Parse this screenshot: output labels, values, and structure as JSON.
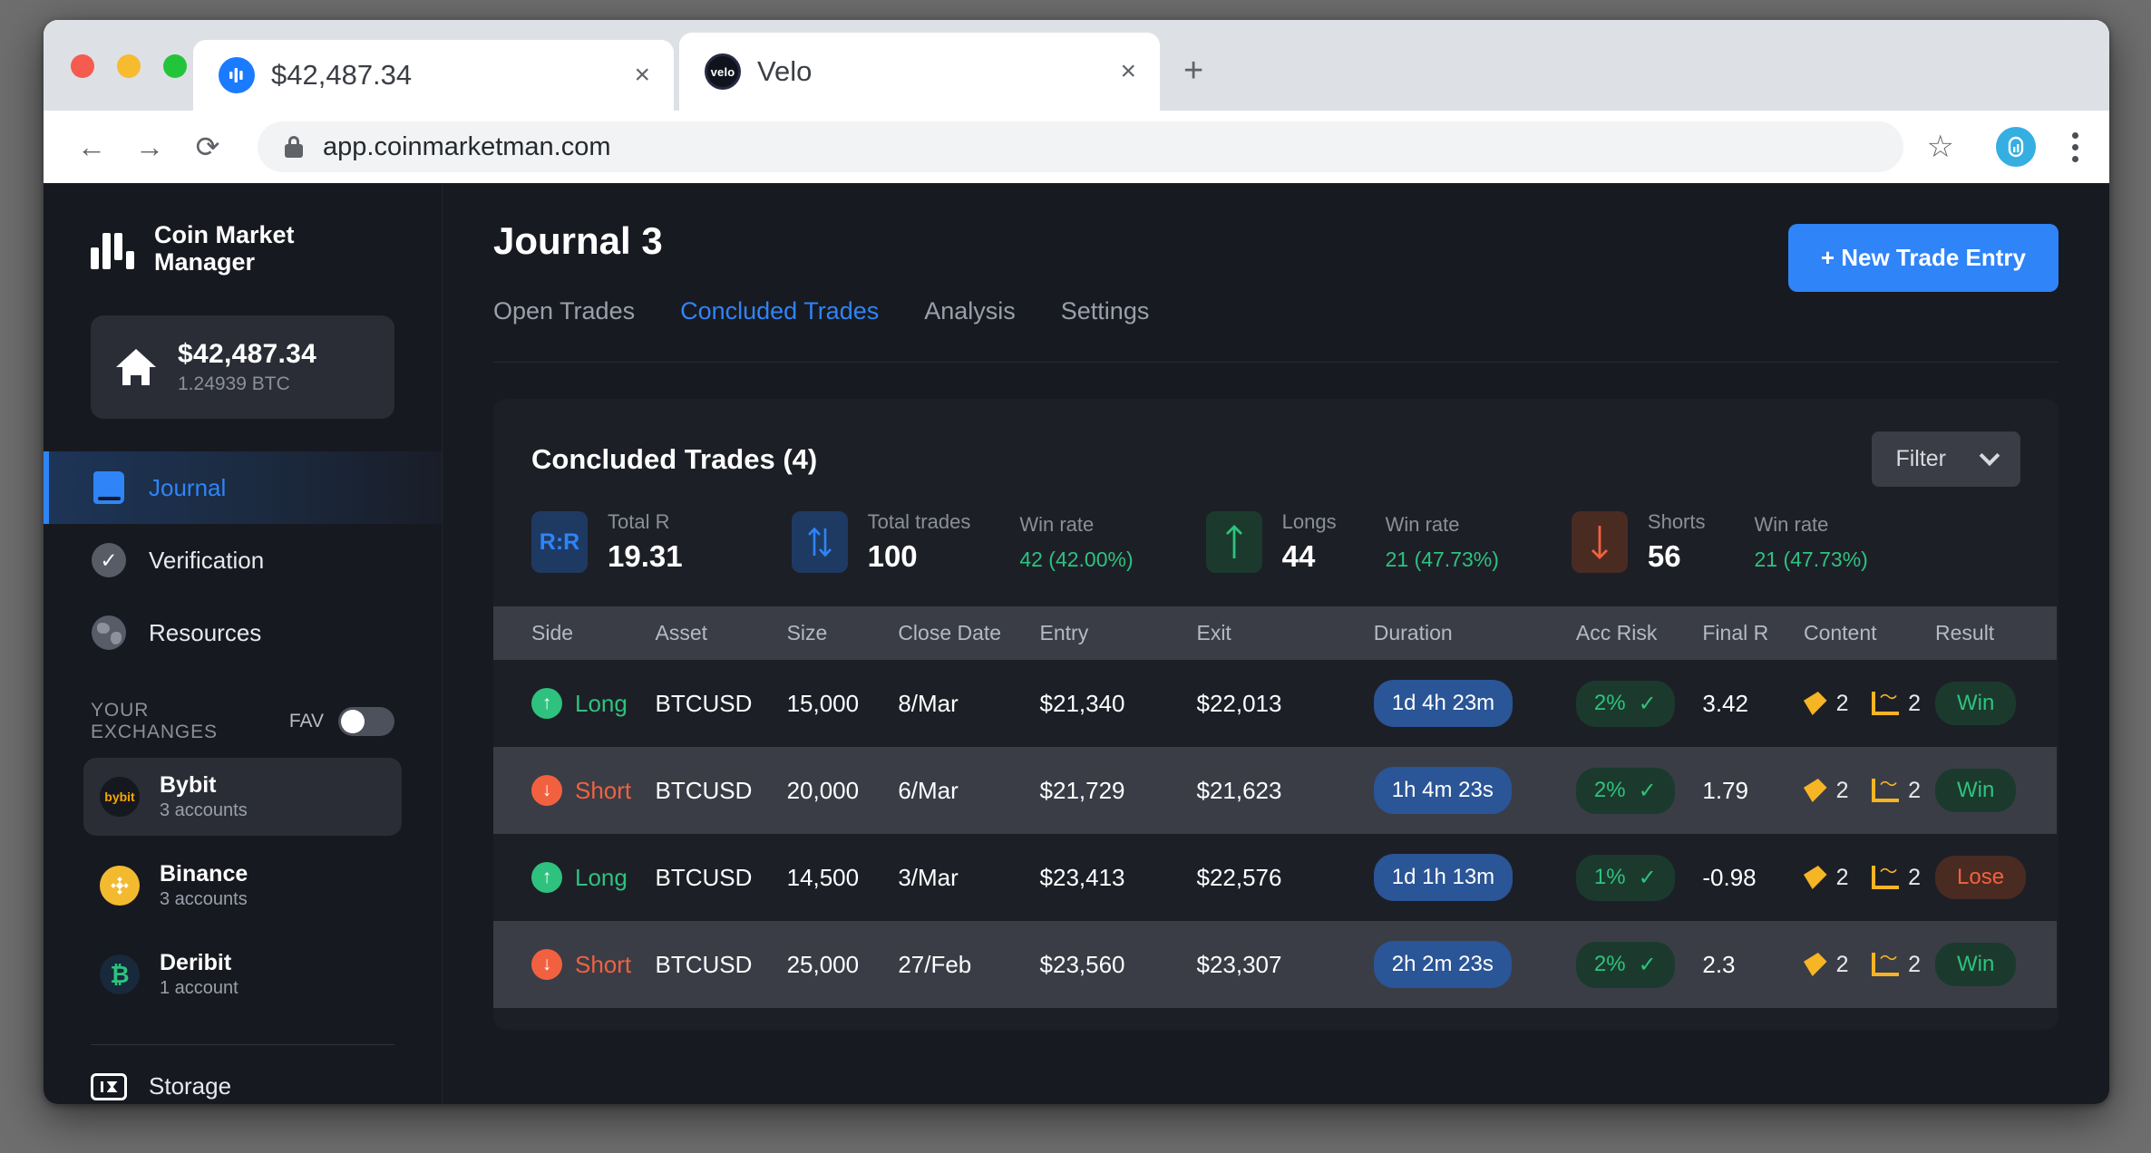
{
  "browser": {
    "tabs": [
      {
        "title": "$42,487.34",
        "favicon": "coinmarketmanager-icon",
        "close": "×"
      },
      {
        "title": "Velo",
        "favicon": "velo-icon",
        "favicon_text": "velo",
        "close": "×"
      }
    ],
    "new_tab": "+",
    "back": "←",
    "forward": "→",
    "reload": "⟳",
    "url": "app.coinmarketman.com",
    "bookmark": "☆",
    "menu": "kebab-menu"
  },
  "sidebar": {
    "logo": {
      "line1": "Coin Market",
      "line2": "Manager"
    },
    "balance": {
      "usd": "$42,487.34",
      "btc": "1.24939 BTC"
    },
    "nav": [
      {
        "label": "Journal",
        "icon": "book-icon",
        "active": true
      },
      {
        "label": "Verification",
        "icon": "check-circle-icon",
        "active": false
      },
      {
        "label": "Resources",
        "icon": "globe-icon",
        "active": false
      }
    ],
    "exchanges_header": "YOUR EXCHANGES",
    "fav_label": "FAV",
    "fav_on": true,
    "exchanges": [
      {
        "name": "Bybit",
        "accounts": "3 accounts",
        "selected": true,
        "mark": "bybit"
      },
      {
        "name": "Binance",
        "accounts": "3 accounts",
        "selected": false,
        "mark": "binance"
      },
      {
        "name": "Deribit",
        "accounts": "1 account",
        "selected": false,
        "mark": "deribit"
      }
    ],
    "storage": "Storage"
  },
  "main": {
    "page_title": "Journal 3",
    "tabs": [
      {
        "label": "Open Trades",
        "active": false
      },
      {
        "label": "Concluded Trades",
        "active": true
      },
      {
        "label": "Analysis",
        "active": false
      },
      {
        "label": "Settings",
        "active": false
      }
    ],
    "new_entry_button": "+ New Trade Entry",
    "card_title": "Concluded Trades (4)",
    "filter_label": "Filter",
    "stats": [
      {
        "icon": "R:R",
        "label": "Total R",
        "value": "19.31"
      },
      {
        "icon": "updown-arrows-icon",
        "label": "Total trades",
        "value": "100",
        "win_label": "Win rate",
        "win_value": "42 (42.00%)"
      },
      {
        "icon": "up-arrow-icon",
        "label": "Longs",
        "value": "44",
        "win_label": "Win rate",
        "win_value": "21 (47.73%)"
      },
      {
        "icon": "down-arrow-icon",
        "label": "Shorts",
        "value": "56",
        "win_label": "Win rate",
        "win_value": "21 (47.73%)"
      }
    ],
    "columns": [
      "Side",
      "Asset",
      "Size",
      "Close Date",
      "Entry",
      "Exit",
      "Duration",
      "Acc Risk",
      "Final R",
      "Content",
      "Result"
    ],
    "rows": [
      {
        "side": "Long",
        "asset": "BTCUSD",
        "size": "15,000",
        "close_date": "8/Mar",
        "entry": "$21,340",
        "exit": "$22,013",
        "duration": "1d 4h 23m",
        "acc_risk": "2%",
        "final_r": "3.42",
        "tags": "2",
        "charts": "2",
        "result": "Win"
      },
      {
        "side": "Short",
        "asset": "BTCUSD",
        "size": "20,000",
        "close_date": "6/Mar",
        "entry": "$21,729",
        "exit": "$21,623",
        "duration": "1h 4m 23s",
        "acc_risk": "2%",
        "final_r": "1.79",
        "tags": "2",
        "charts": "2",
        "result": "Win"
      },
      {
        "side": "Long",
        "asset": "BTCUSD",
        "size": "14,500",
        "close_date": "3/Mar",
        "entry": "$23,413",
        "exit": "$22,576",
        "duration": "1d 1h 13m",
        "acc_risk": "1%",
        "final_r": "-0.98",
        "tags": "2",
        "charts": "2",
        "result": "Lose"
      },
      {
        "side": "Short",
        "asset": "BTCUSD",
        "size": "25,000",
        "close_date": "27/Feb",
        "entry": "$23,560",
        "exit": "$23,307",
        "duration": "2h 2m 23s",
        "acc_risk": "2%",
        "final_r": "2.3",
        "tags": "2",
        "charts": "2",
        "result": "Win"
      }
    ]
  },
  "colors": {
    "accent_blue": "#2f84f7",
    "green": "#2ec27e",
    "red": "#f2613f",
    "amber": "#f6b524",
    "app_bg": "#181a21",
    "card_bg": "#1d1f27",
    "row_alt_bg": "#3a3d46"
  }
}
